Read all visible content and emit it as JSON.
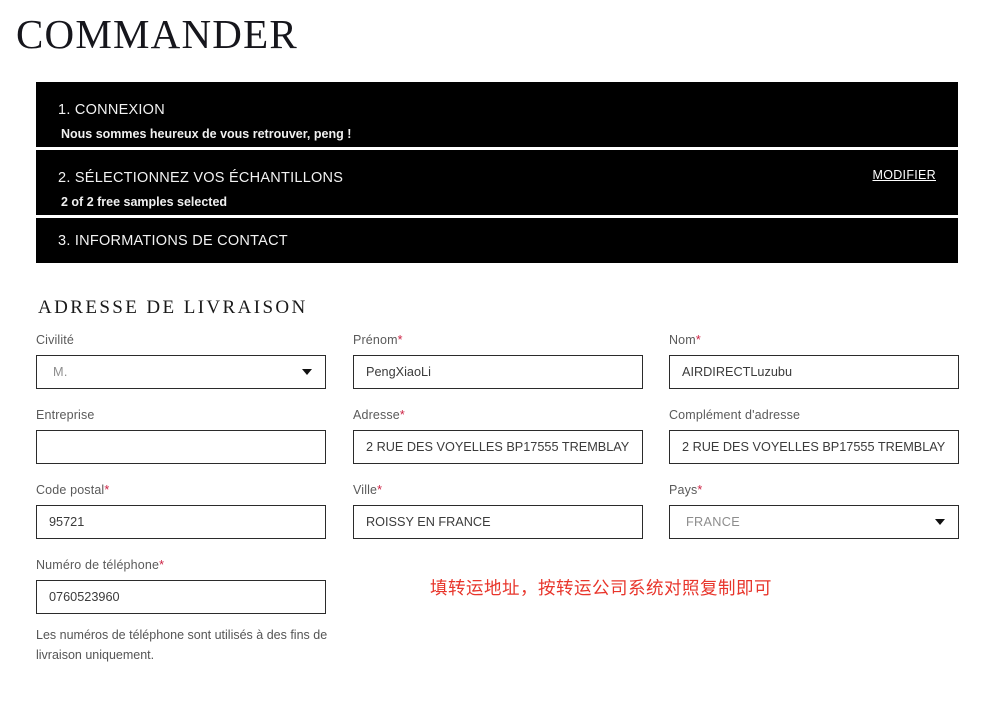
{
  "header": {
    "title": "COMMANDER"
  },
  "steps": [
    {
      "title": "1. CONNEXION",
      "subtitle": "Nous sommes heureux de vous retrouver, peng !",
      "action_label": ""
    },
    {
      "title": "2. SÉLECTIONNEZ VOS ÉCHANTILLONS",
      "subtitle": "2 of 2 free samples selected",
      "action_label": "MODIFIER"
    },
    {
      "title": "3. INFORMATIONS DE CONTACT",
      "subtitle": "",
      "action_label": ""
    }
  ],
  "shipping": {
    "section_title": "ADRESSE DE LIVRAISON",
    "fields": {
      "civility": {
        "label": "Civilité",
        "value": "M.",
        "required": false,
        "type": "select",
        "icon": "chevron-down-icon"
      },
      "firstname": {
        "label": "Prénom",
        "required_mark": "*",
        "value": "PengXiaoLi",
        "placeholder": "",
        "type": "text"
      },
      "lastname": {
        "label": "Nom",
        "required_mark": "*",
        "value": "AIRDIRECTLuzubu",
        "placeholder": "",
        "type": "text"
      },
      "company": {
        "label": "Entreprise",
        "value": "",
        "placeholder": "",
        "type": "text"
      },
      "address": {
        "label": "Adresse",
        "required_mark": "*",
        "value": "2 RUE DES VOYELLES BP17555 TREMBLAY",
        "placeholder": "",
        "type": "text"
      },
      "address2": {
        "label": "Complément d'adresse",
        "value": "2 RUE DES VOYELLES BP17555 TREMBLAY",
        "placeholder": "",
        "type": "text"
      },
      "postcode": {
        "label": "Code postal",
        "required_mark": "*",
        "value": "95721",
        "placeholder": "",
        "type": "text"
      },
      "city": {
        "label": "Ville",
        "required_mark": "*",
        "value": "ROISSY EN FRANCE",
        "placeholder": "",
        "type": "text"
      },
      "country": {
        "label": "Pays",
        "required_mark": "*",
        "value": "FRANCE",
        "type": "select",
        "icon": "chevron-down-icon"
      },
      "phone": {
        "label": "Numéro de téléphone",
        "required_mark": "*",
        "value": "0760523960",
        "placeholder": "",
        "type": "text"
      }
    },
    "phone_help": "Les numéros de téléphone sont utilisés à des fins de livraison uniquement."
  },
  "annotation": {
    "text": "填转运地址，按转运公司系统对照复制即可",
    "color": "#e8352b"
  },
  "colors": {
    "bar_background": "#000000",
    "bar_text": "#ffffff",
    "required_asterisk": "#cc2244",
    "input_border": "#2b2b2b",
    "label_text": "#5a5a5a"
  }
}
